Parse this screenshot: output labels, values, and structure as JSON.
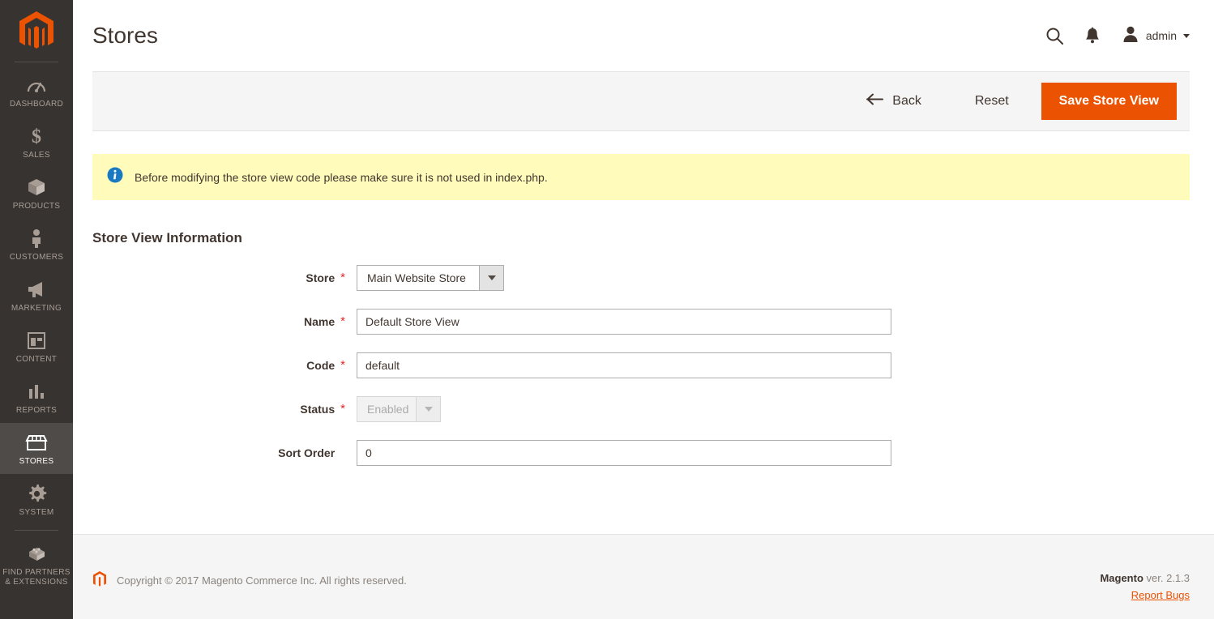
{
  "sidebar": {
    "logo_name": "magento-logo",
    "items": [
      {
        "label": "DASHBOARD",
        "icon": "dashboard-gauge-icon",
        "active": false
      },
      {
        "label": "SALES",
        "icon": "dollar-sign-icon",
        "active": false
      },
      {
        "label": "PRODUCTS",
        "icon": "box-icon",
        "active": false
      },
      {
        "label": "CUSTOMERS",
        "icon": "person-icon",
        "active": false
      },
      {
        "label": "MARKETING",
        "icon": "megaphone-icon",
        "active": false
      },
      {
        "label": "CONTENT",
        "icon": "layout-panel-icon",
        "active": false
      },
      {
        "label": "REPORTS",
        "icon": "bar-chart-icon",
        "active": false
      },
      {
        "label": "STORES",
        "icon": "storefront-icon",
        "active": true
      },
      {
        "label": "SYSTEM",
        "icon": "gear-icon",
        "active": false
      },
      {
        "label": "FIND PARTNERS\n& EXTENSIONS",
        "label_line1": "FIND PARTNERS",
        "label_line2": "& EXTENSIONS",
        "icon": "extension-blocks-icon",
        "active": false
      }
    ]
  },
  "header": {
    "title": "Stores",
    "search_icon": "search-icon",
    "notifications_icon": "bell-icon",
    "user_icon": "user-avatar-icon",
    "user_name": "admin",
    "caret_icon": "chevron-down-icon"
  },
  "page_actions": {
    "back_label": "Back",
    "back_icon": "arrow-left-icon",
    "reset_label": "Reset",
    "save_label": "Save Store View"
  },
  "notice": {
    "icon": "info-circle-icon",
    "text": "Before modifying the store view code please make sure it is not used in index.php."
  },
  "form": {
    "section_title": "Store View Information",
    "fields": [
      {
        "label": "Store",
        "required": true,
        "type": "select",
        "value": "Main Website Store",
        "disabled": false
      },
      {
        "label": "Name",
        "required": true,
        "type": "text",
        "value": "Default Store View",
        "placeholder": ""
      },
      {
        "label": "Code",
        "required": true,
        "type": "text",
        "value": "default",
        "placeholder": ""
      },
      {
        "label": "Status",
        "required": true,
        "type": "select",
        "value": "Enabled",
        "disabled": true
      },
      {
        "label": "Sort Order",
        "required": false,
        "type": "text",
        "value": "0",
        "placeholder": ""
      }
    ]
  },
  "footer": {
    "logo_icon": "magento-logo-small",
    "copyright": "Copyright © 2017 Magento Commerce Inc. All rights reserved.",
    "brand": "Magento",
    "version": " ver. 2.1.3",
    "report_bugs": "Report Bugs"
  },
  "colors": {
    "accent_orange": "#eb5202",
    "sidebar_bg": "#373330",
    "sidebar_active": "#4f4b48",
    "notice_bg": "#fffbbb",
    "required_star": "#e22626",
    "info_blue": "#0079c1"
  }
}
